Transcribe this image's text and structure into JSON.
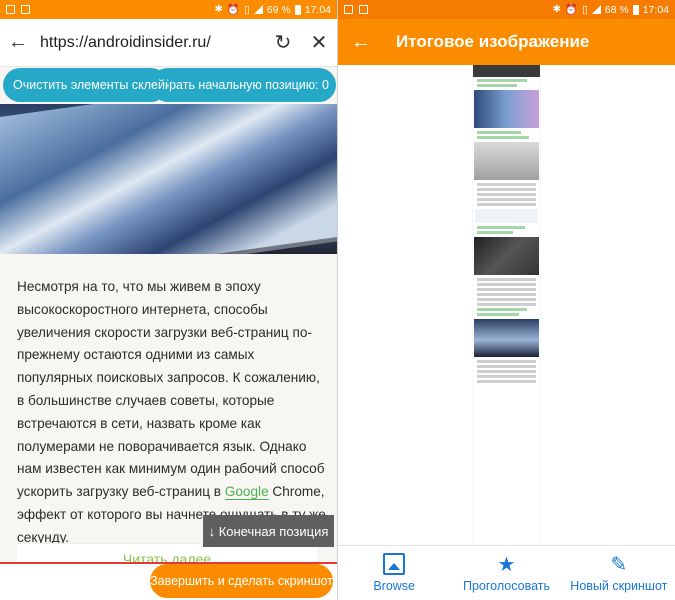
{
  "left": {
    "status": {
      "battery": "69 %",
      "time": "17:04"
    },
    "browser": {
      "url": "https://androidinsider.ru/"
    },
    "pills": {
      "clear": "Очистить элементы склейки",
      "set_start": "Выбрать начальную позицию: 0"
    },
    "article": {
      "text_before": "Несмотря на то, что мы живем в эпоху высокоскоростного интернета, способы увеличения скорости загрузки веб-страниц по-прежнему остаются одними из самых популярных поисковых запросов. К сожалению, в большинстве случаев советы, которые встречаются в сети, назвать кроме как полумерами не поворачивается язык. Однако нам известен как минимум один рабочий способ ускорить загрузку веб-страниц в ",
      "link": "Google",
      "text_after": " Chrome, эффект от которого вы начнете ощущать в ту же секунду."
    },
    "end_position": "↓ Конечная позиция",
    "read_more": "Читать далее",
    "finish_button": "Завершить и сделать скриншот"
  },
  "right": {
    "status": {
      "battery": "68 %",
      "time": "17:04"
    },
    "appbar": {
      "title": "Итоговое изображение"
    },
    "bottom_nav": [
      {
        "label": "Browse",
        "icon": "image-icon"
      },
      {
        "label": "Проголосовать",
        "icon": "star-icon"
      },
      {
        "label": "Новый скриншот",
        "icon": "pencil-icon"
      }
    ]
  },
  "colors": {
    "orange": "#fb8c00",
    "teal": "#26a9c7",
    "blue": "#1976d2",
    "green_link": "#4caf50"
  }
}
